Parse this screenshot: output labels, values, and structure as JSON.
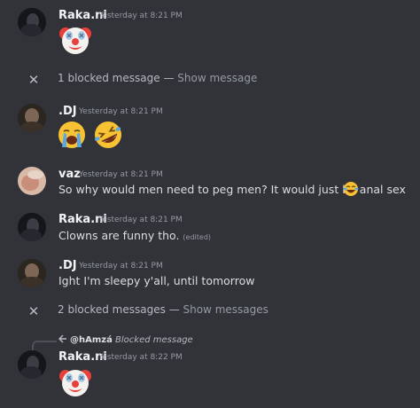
{
  "messages": [
    {
      "author": "Raka.ni",
      "timestamp": "Yesterday at 8:21 PM",
      "emoji": "clown-face"
    },
    {
      "author": ".DJ",
      "timestamp": "Yesterday at 8:21 PM",
      "emoji": [
        "loudly-crying-face",
        "rolling-on-floor-laughing-face"
      ]
    },
    {
      "author": "vaz",
      "timestamp": "Yesterday at 8:21 PM",
      "text": "So why would men need to peg men? It would just be anal sex",
      "emoji": "face-with-tears-of-joy"
    },
    {
      "author": "Raka.ni",
      "timestamp": "Yesterday at 8:21 PM",
      "text": "Clowns are funny tho.",
      "edited": "(edited)"
    },
    {
      "author": ".DJ",
      "timestamp": "Yesterday at 8:21 PM",
      "text": "Ight I'm sleepy y'all, until tomorrow"
    },
    {
      "author": "Raka.ni",
      "timestamp": "Yesterday at 8:22 PM",
      "emoji": "clown-face",
      "reply": {
        "author": "@hAmzá",
        "text": "Blocked message"
      }
    }
  ],
  "blocked": [
    {
      "count_text": "1 blocked message",
      "separator": "—",
      "action": "Show message"
    },
    {
      "count_text": "2 blocked messages",
      "separator": "—",
      "action": "Show messages"
    }
  ],
  "icons": {
    "close": "close-icon",
    "reply": "reply-arrow-icon"
  },
  "colors": {
    "background": "#313338",
    "username": "#f2f3f5",
    "muted": "#949ba4"
  }
}
